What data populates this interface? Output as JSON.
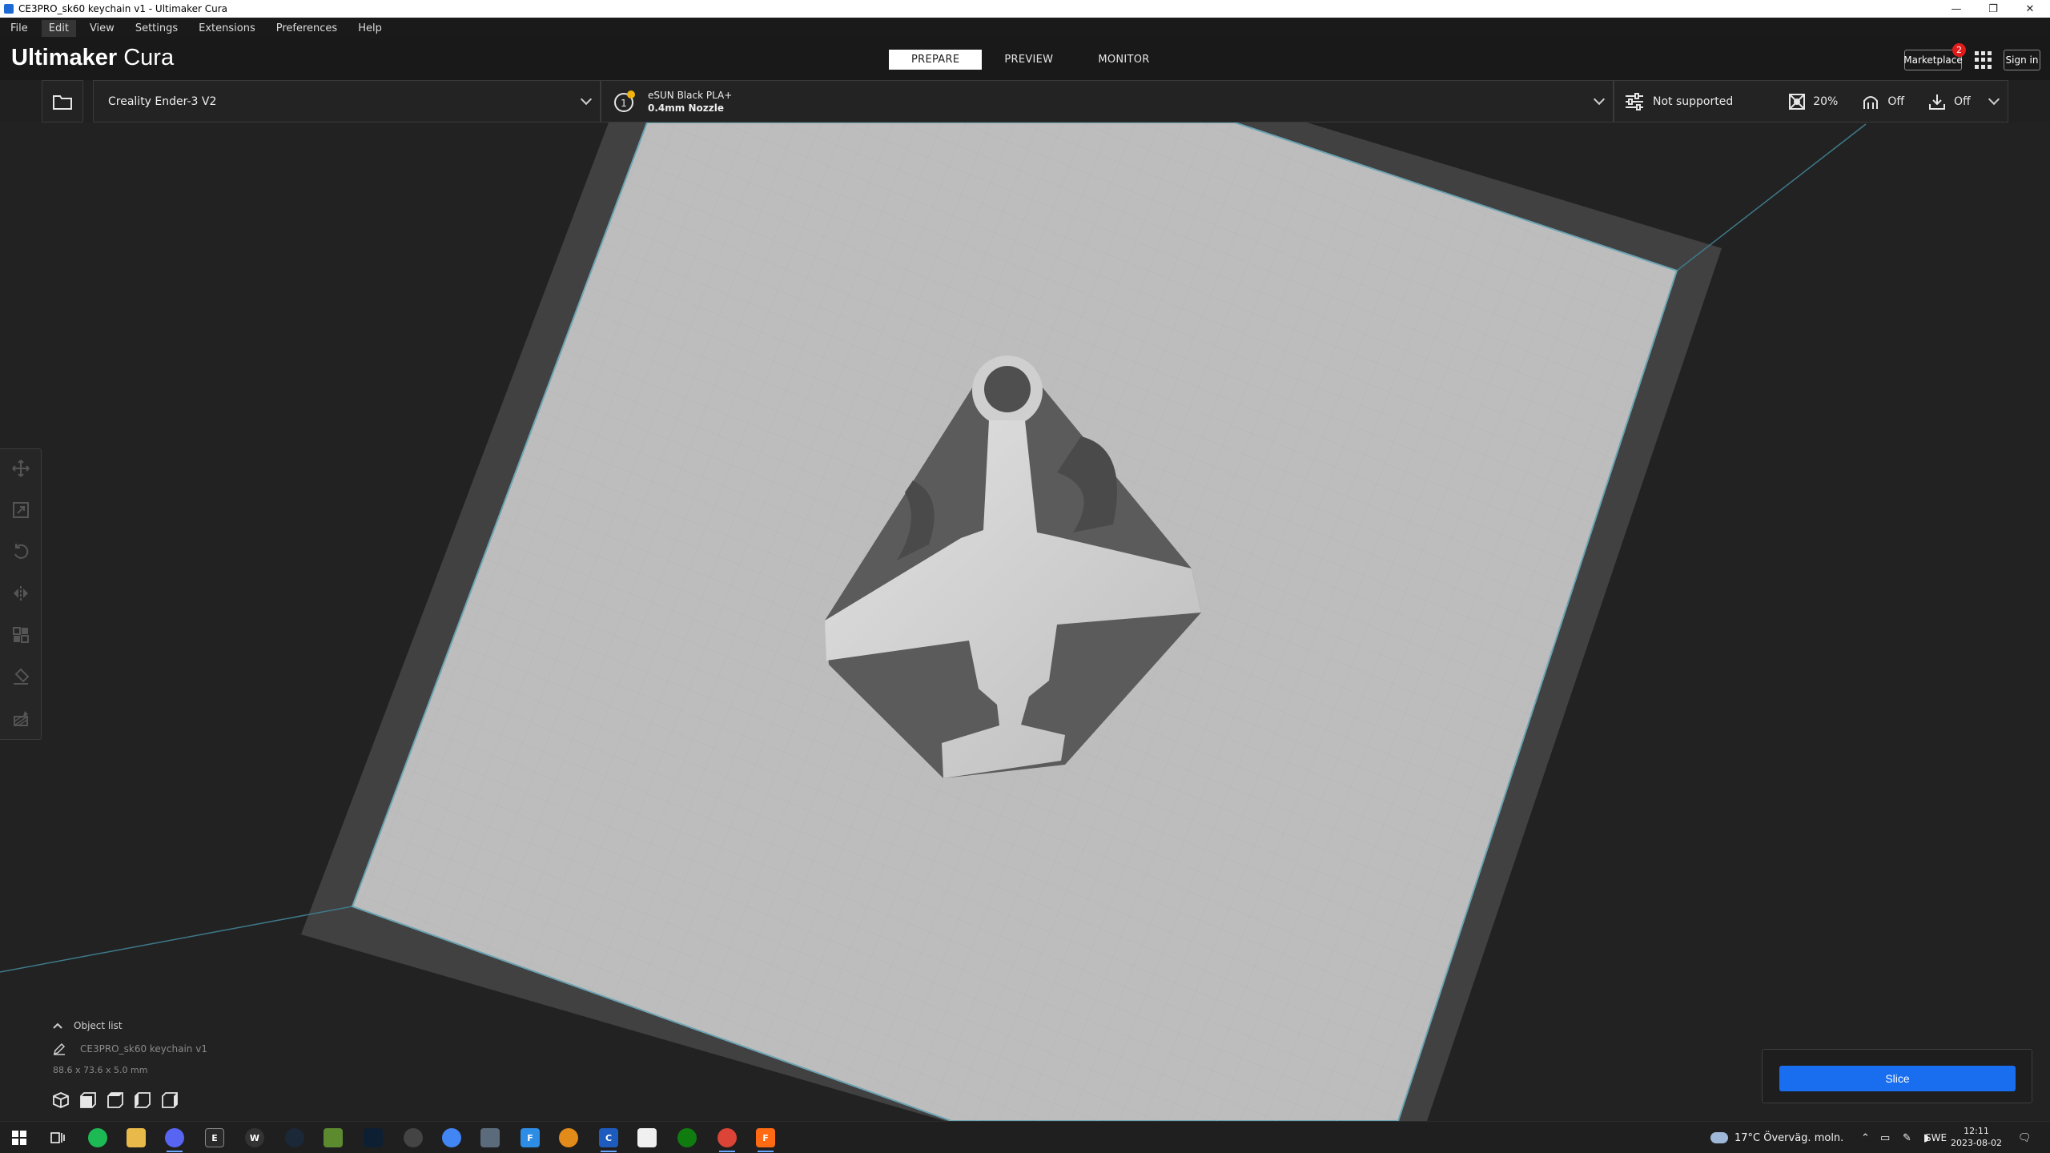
{
  "window": {
    "title": "CE3PRO_sk60 keychain v1 - Ultimaker Cura",
    "controls": [
      "minimize",
      "restore",
      "close"
    ]
  },
  "menu": [
    "File",
    "Edit",
    "View",
    "Settings",
    "Extensions",
    "Preferences",
    "Help"
  ],
  "header": {
    "logo_bold": "Ultimaker",
    "logo_light": " Cura",
    "tabs": [
      "PREPARE",
      "PREVIEW",
      "MONITOR"
    ],
    "active_tab": "PREPARE",
    "marketplace_label": "Marketplace",
    "marketplace_badge": "2",
    "signin_label": "Sign in"
  },
  "printer": {
    "machine": "Creality Ender-3 V2",
    "material": "eSUN Black PLA+",
    "nozzle": "0.4mm Nozzle",
    "profile": "Not supported",
    "infill": "20%",
    "support": "Off",
    "adhesion": "Off"
  },
  "tools": [
    "move-tool",
    "scale-tool",
    "rotate-tool",
    "mirror-tool",
    "per-model-settings-tool",
    "support-blocker-tool",
    "paint-tool"
  ],
  "object_list": {
    "title": "Object list",
    "name": "CE3PRO_sk60 keychain v1",
    "dimensions": "88.6 x 73.6 x 5.0 mm"
  },
  "slice": {
    "label": "Slice"
  },
  "taskbar": {
    "weather": "17°C  Överväg. moln.",
    "language": "SWE",
    "time": "12:11",
    "date": "2023-08-02"
  },
  "colors": {
    "accent": "#196ef0",
    "plate": "#bdbdbd",
    "model_face": "#cdcdcd",
    "model_dark": "#5a5a5a",
    "badge": "#e21b1b"
  }
}
